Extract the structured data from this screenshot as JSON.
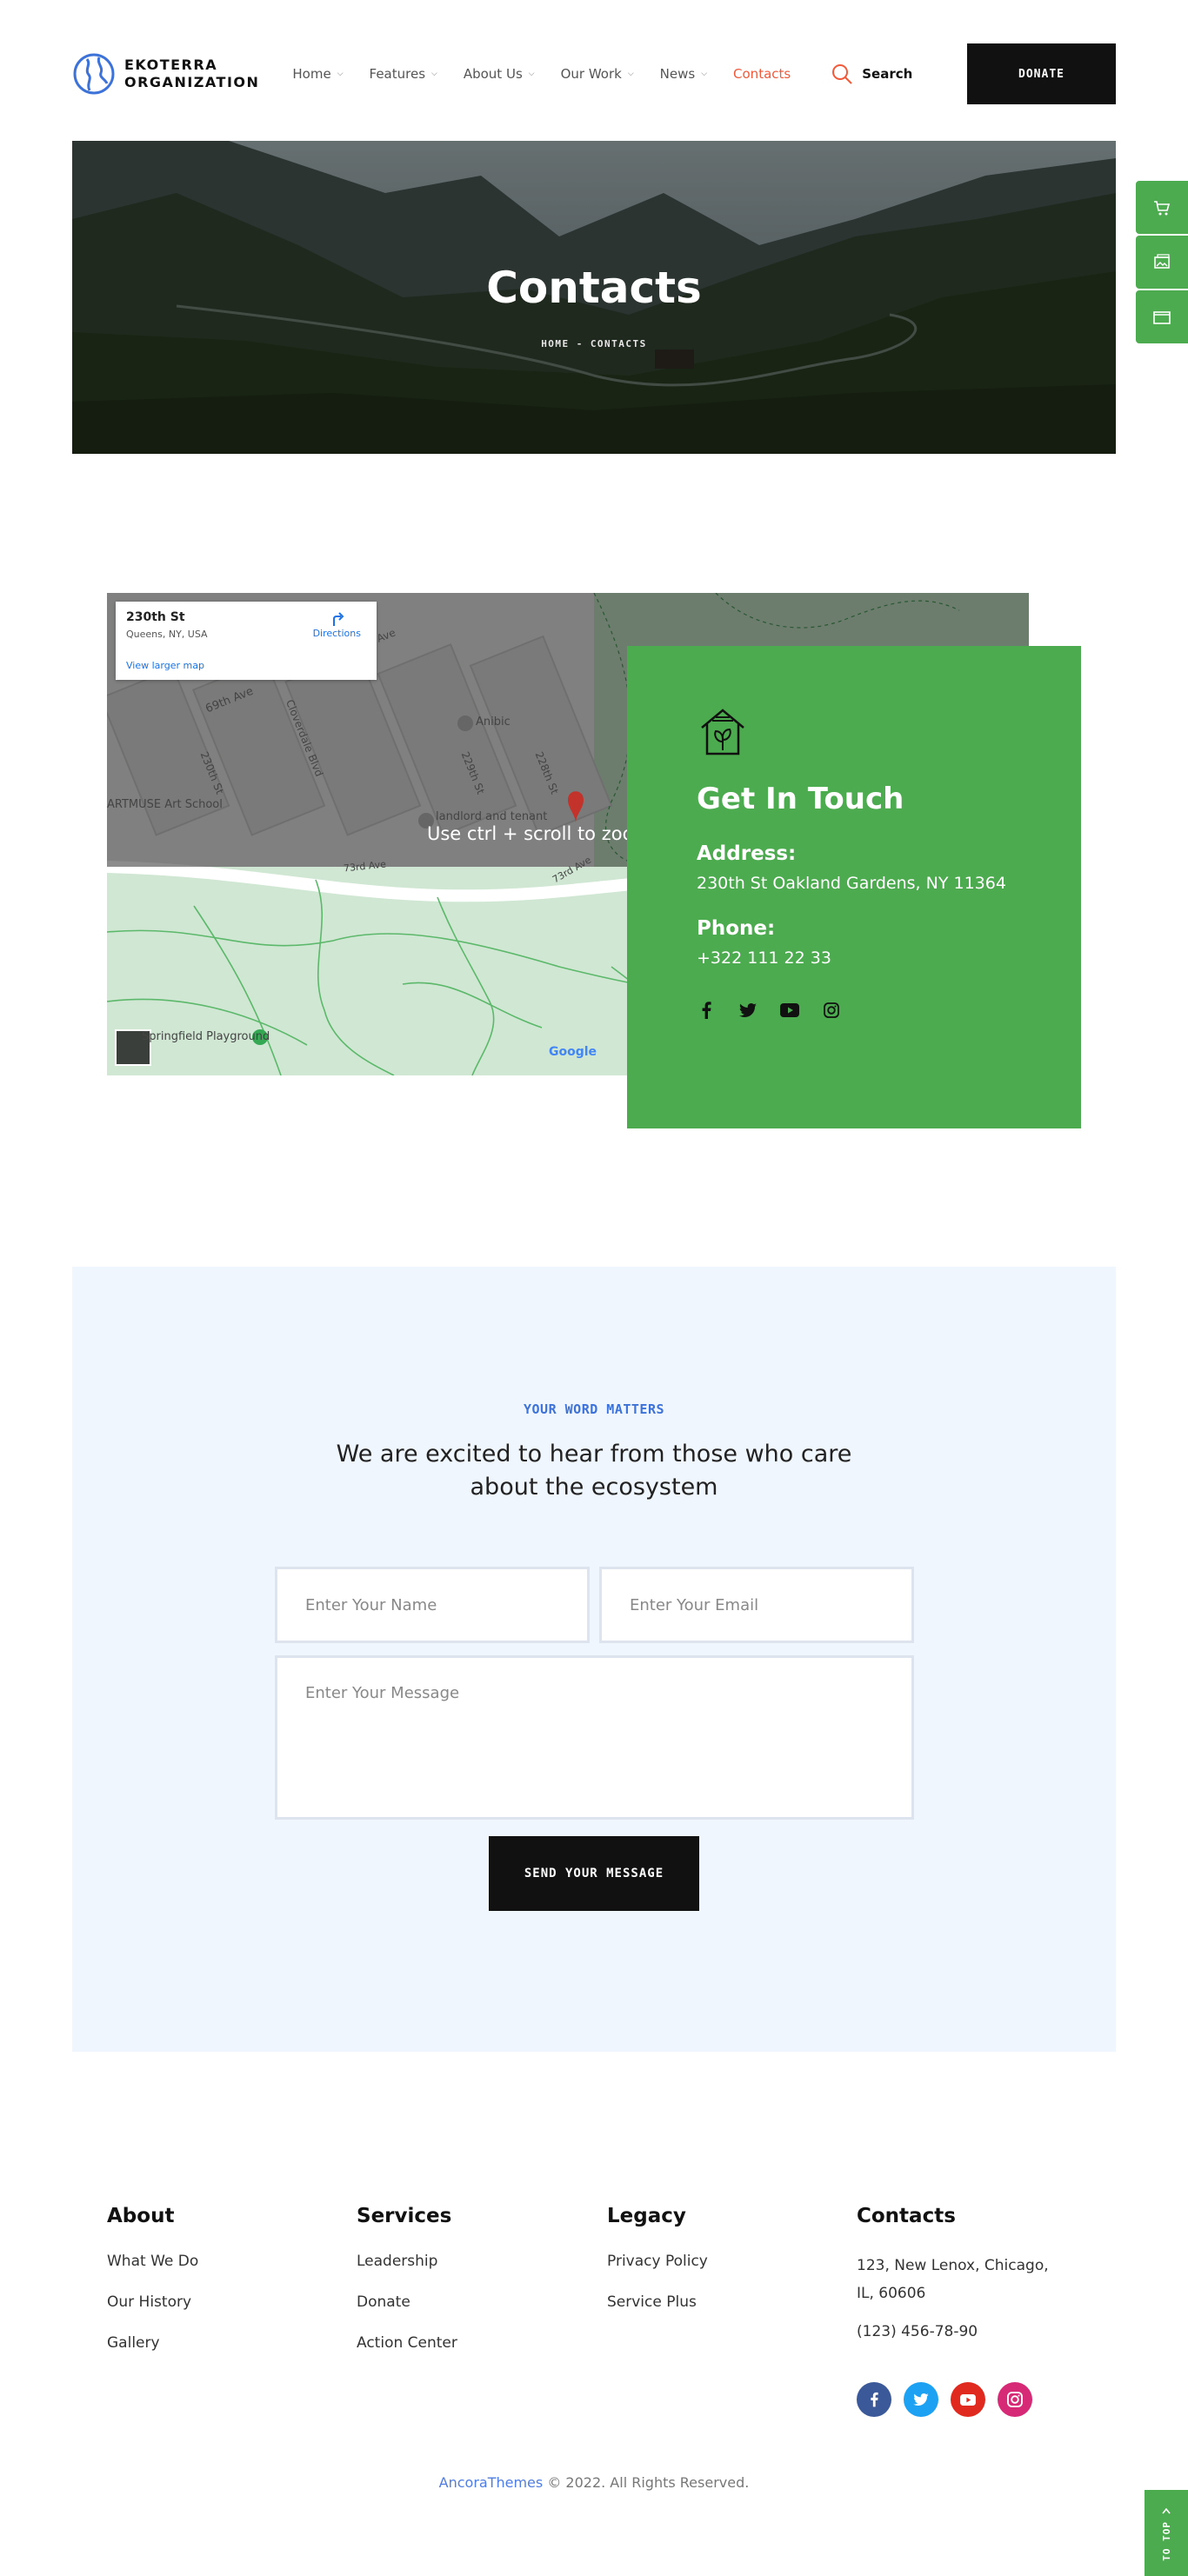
{
  "header": {
    "logo_line1": "EKOTERRA",
    "logo_line2": "ORGANIZATION",
    "nav": [
      {
        "label": "Home",
        "dropdown": true
      },
      {
        "label": "Features",
        "dropdown": true
      },
      {
        "label": "About Us",
        "dropdown": true
      },
      {
        "label": "Our Work",
        "dropdown": true
      },
      {
        "label": "News",
        "dropdown": true
      },
      {
        "label": "Contacts",
        "dropdown": false,
        "active": true
      }
    ],
    "search_label": "Search",
    "donate_label": "DONATE"
  },
  "side_buttons": [
    "cart-icon",
    "image-icon",
    "folder-icon"
  ],
  "hero": {
    "title": "Contacts",
    "breadcrumb_home": "HOME",
    "breadcrumb_sep": "-",
    "breadcrumb_current": "CONTACTS"
  },
  "map": {
    "popup_title": "230th St",
    "popup_sub": "Queens, NY, USA",
    "directions_label": "Directions",
    "larger_map_label": "View larger map",
    "overlay_hint": "Use ctrl + scroll to zoom",
    "labels": [
      "69th Ave",
      "Cloverdale Blvd",
      "230th St",
      "229th St",
      "228th St",
      "Anibic",
      "ARTMUSE Art School",
      "landlord and tenant",
      "73rd Ave",
      "73rd Ave",
      "Springfield Playground",
      "Ave"
    ],
    "google_label": "Google"
  },
  "contact_card": {
    "title": "Get In Touch",
    "address_label": "Address:",
    "address_value": "230th St Oakland Gardens, NY 11364",
    "phone_label": "Phone:",
    "phone_value": "+322 111 22 33",
    "social": [
      "facebook-icon",
      "twitter-icon",
      "youtube-icon",
      "instagram-icon"
    ]
  },
  "form": {
    "eyebrow": "YOUR WORD MATTERS",
    "heading": "We are excited to hear from those who care about the ecosystem",
    "name_placeholder": "Enter Your Name",
    "email_placeholder": "Enter Your Email",
    "message_placeholder": "Enter Your Message",
    "submit_label": "SEND YOUR MESSAGE"
  },
  "footer": {
    "about": {
      "title": "About",
      "links": [
        "What We Do",
        "Our History",
        "Gallery"
      ]
    },
    "services": {
      "title": "Services",
      "links": [
        "Leadership",
        "Donate",
        "Action Center"
      ]
    },
    "legacy": {
      "title": "Legacy",
      "links": [
        "Privacy Policy",
        "Service Plus"
      ]
    },
    "contacts": {
      "title": "Contacts",
      "address": "123, New Lenox, Chicago, IL, 60606",
      "phone": "(123) 456-78-90",
      "social": [
        {
          "icon": "facebook-icon",
          "color": "#3b5998"
        },
        {
          "icon": "twitter-icon",
          "color": "#1da1f2"
        },
        {
          "icon": "youtube-icon",
          "color": "#e02a20"
        },
        {
          "icon": "instagram-icon",
          "color": "#d62976"
        }
      ]
    },
    "copyright_brand": "AncoraThemes",
    "copyright_text": " © 2022. All Rights Reserved.",
    "to_top_label": "TO TOP"
  },
  "colors": {
    "accent_green": "#4caa4f",
    "accent_blue": "#3d72d8",
    "active_nav": "#f15a3a",
    "dark": "#111111",
    "form_bg": "#eff6fd"
  }
}
